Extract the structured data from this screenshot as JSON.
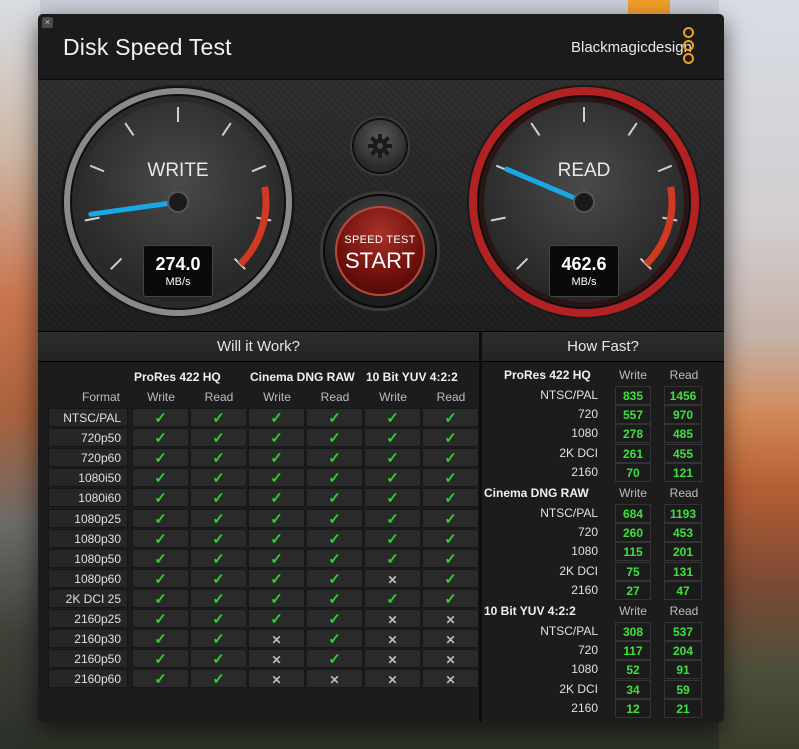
{
  "window": {
    "title": "Disk Speed Test",
    "brand": "Blackmagicdesign",
    "close_glyph": "×"
  },
  "gauges": {
    "write": {
      "label": "WRITE",
      "value": "274.0",
      "unit": "MB/s",
      "needle_color": "#19a8e6"
    },
    "read": {
      "label": "READ",
      "value": "462.6",
      "unit": "MB/s",
      "needle_color": "#19a8e6"
    }
  },
  "start_button": {
    "line1": "SPEED TEST",
    "line2": "START"
  },
  "settings_button": {
    "icon": "gear-icon"
  },
  "will_it_work": {
    "heading": "Will it Work?",
    "format_header": "Format",
    "groups": [
      {
        "name": "ProRes 422 HQ",
        "cols": [
          "Write",
          "Read"
        ]
      },
      {
        "name": "Cinema DNG RAW",
        "cols": [
          "Write",
          "Read"
        ]
      },
      {
        "name": "10 Bit YUV 4:2:2",
        "cols": [
          "Write",
          "Read"
        ]
      }
    ],
    "rows": [
      {
        "label": "NTSC/PAL",
        "cells": [
          1,
          1,
          1,
          1,
          1,
          1
        ]
      },
      {
        "label": "720p50",
        "cells": [
          1,
          1,
          1,
          1,
          1,
          1
        ]
      },
      {
        "label": "720p60",
        "cells": [
          1,
          1,
          1,
          1,
          1,
          1
        ]
      },
      {
        "label": "1080i50",
        "cells": [
          1,
          1,
          1,
          1,
          1,
          1
        ]
      },
      {
        "label": "1080i60",
        "cells": [
          1,
          1,
          1,
          1,
          1,
          1
        ]
      },
      {
        "label": "1080p25",
        "cells": [
          1,
          1,
          1,
          1,
          1,
          1
        ]
      },
      {
        "label": "1080p30",
        "cells": [
          1,
          1,
          1,
          1,
          1,
          1
        ]
      },
      {
        "label": "1080p50",
        "cells": [
          1,
          1,
          1,
          1,
          1,
          1
        ]
      },
      {
        "label": "1080p60",
        "cells": [
          1,
          1,
          1,
          1,
          0,
          1
        ]
      },
      {
        "label": "2K DCI 25",
        "cells": [
          1,
          1,
          1,
          1,
          1,
          1
        ]
      },
      {
        "label": "2160p25",
        "cells": [
          1,
          1,
          1,
          1,
          0,
          0
        ]
      },
      {
        "label": "2160p30",
        "cells": [
          1,
          1,
          0,
          1,
          0,
          0
        ]
      },
      {
        "label": "2160p50",
        "cells": [
          1,
          1,
          0,
          1,
          0,
          0
        ]
      },
      {
        "label": "2160p60",
        "cells": [
          1,
          1,
          0,
          0,
          0,
          0
        ]
      }
    ],
    "ok_glyph": "✓",
    "no_glyph": "✕",
    "colors": {
      "ok": "#2ed02e",
      "no": "#bdbdbd"
    }
  },
  "how_fast": {
    "heading": "How Fast?",
    "groups": [
      {
        "name": "ProRes 422 HQ",
        "cols": [
          "Write",
          "Read"
        ],
        "rows": [
          {
            "label": "NTSC/PAL",
            "write": "835",
            "read": "1456"
          },
          {
            "label": "720",
            "write": "557",
            "read": "970"
          },
          {
            "label": "1080",
            "write": "278",
            "read": "485"
          },
          {
            "label": "2K DCI",
            "write": "261",
            "read": "455"
          },
          {
            "label": "2160",
            "write": "70",
            "read": "121"
          }
        ]
      },
      {
        "name": "Cinema DNG RAW",
        "cols": [
          "Write",
          "Read"
        ],
        "rows": [
          {
            "label": "NTSC/PAL",
            "write": "684",
            "read": "1193"
          },
          {
            "label": "720",
            "write": "260",
            "read": "453"
          },
          {
            "label": "1080",
            "write": "115",
            "read": "201"
          },
          {
            "label": "2K DCI",
            "write": "75",
            "read": "131"
          },
          {
            "label": "2160",
            "write": "27",
            "read": "47"
          }
        ]
      },
      {
        "name": "10 Bit YUV 4:2:2",
        "cols": [
          "Write",
          "Read"
        ],
        "rows": [
          {
            "label": "NTSC/PAL",
            "write": "308",
            "read": "537"
          },
          {
            "label": "720",
            "write": "117",
            "read": "204"
          },
          {
            "label": "1080",
            "write": "52",
            "read": "91"
          },
          {
            "label": "2K DCI",
            "write": "34",
            "read": "59"
          },
          {
            "label": "2160",
            "write": "12",
            "read": "21"
          }
        ]
      }
    ]
  }
}
